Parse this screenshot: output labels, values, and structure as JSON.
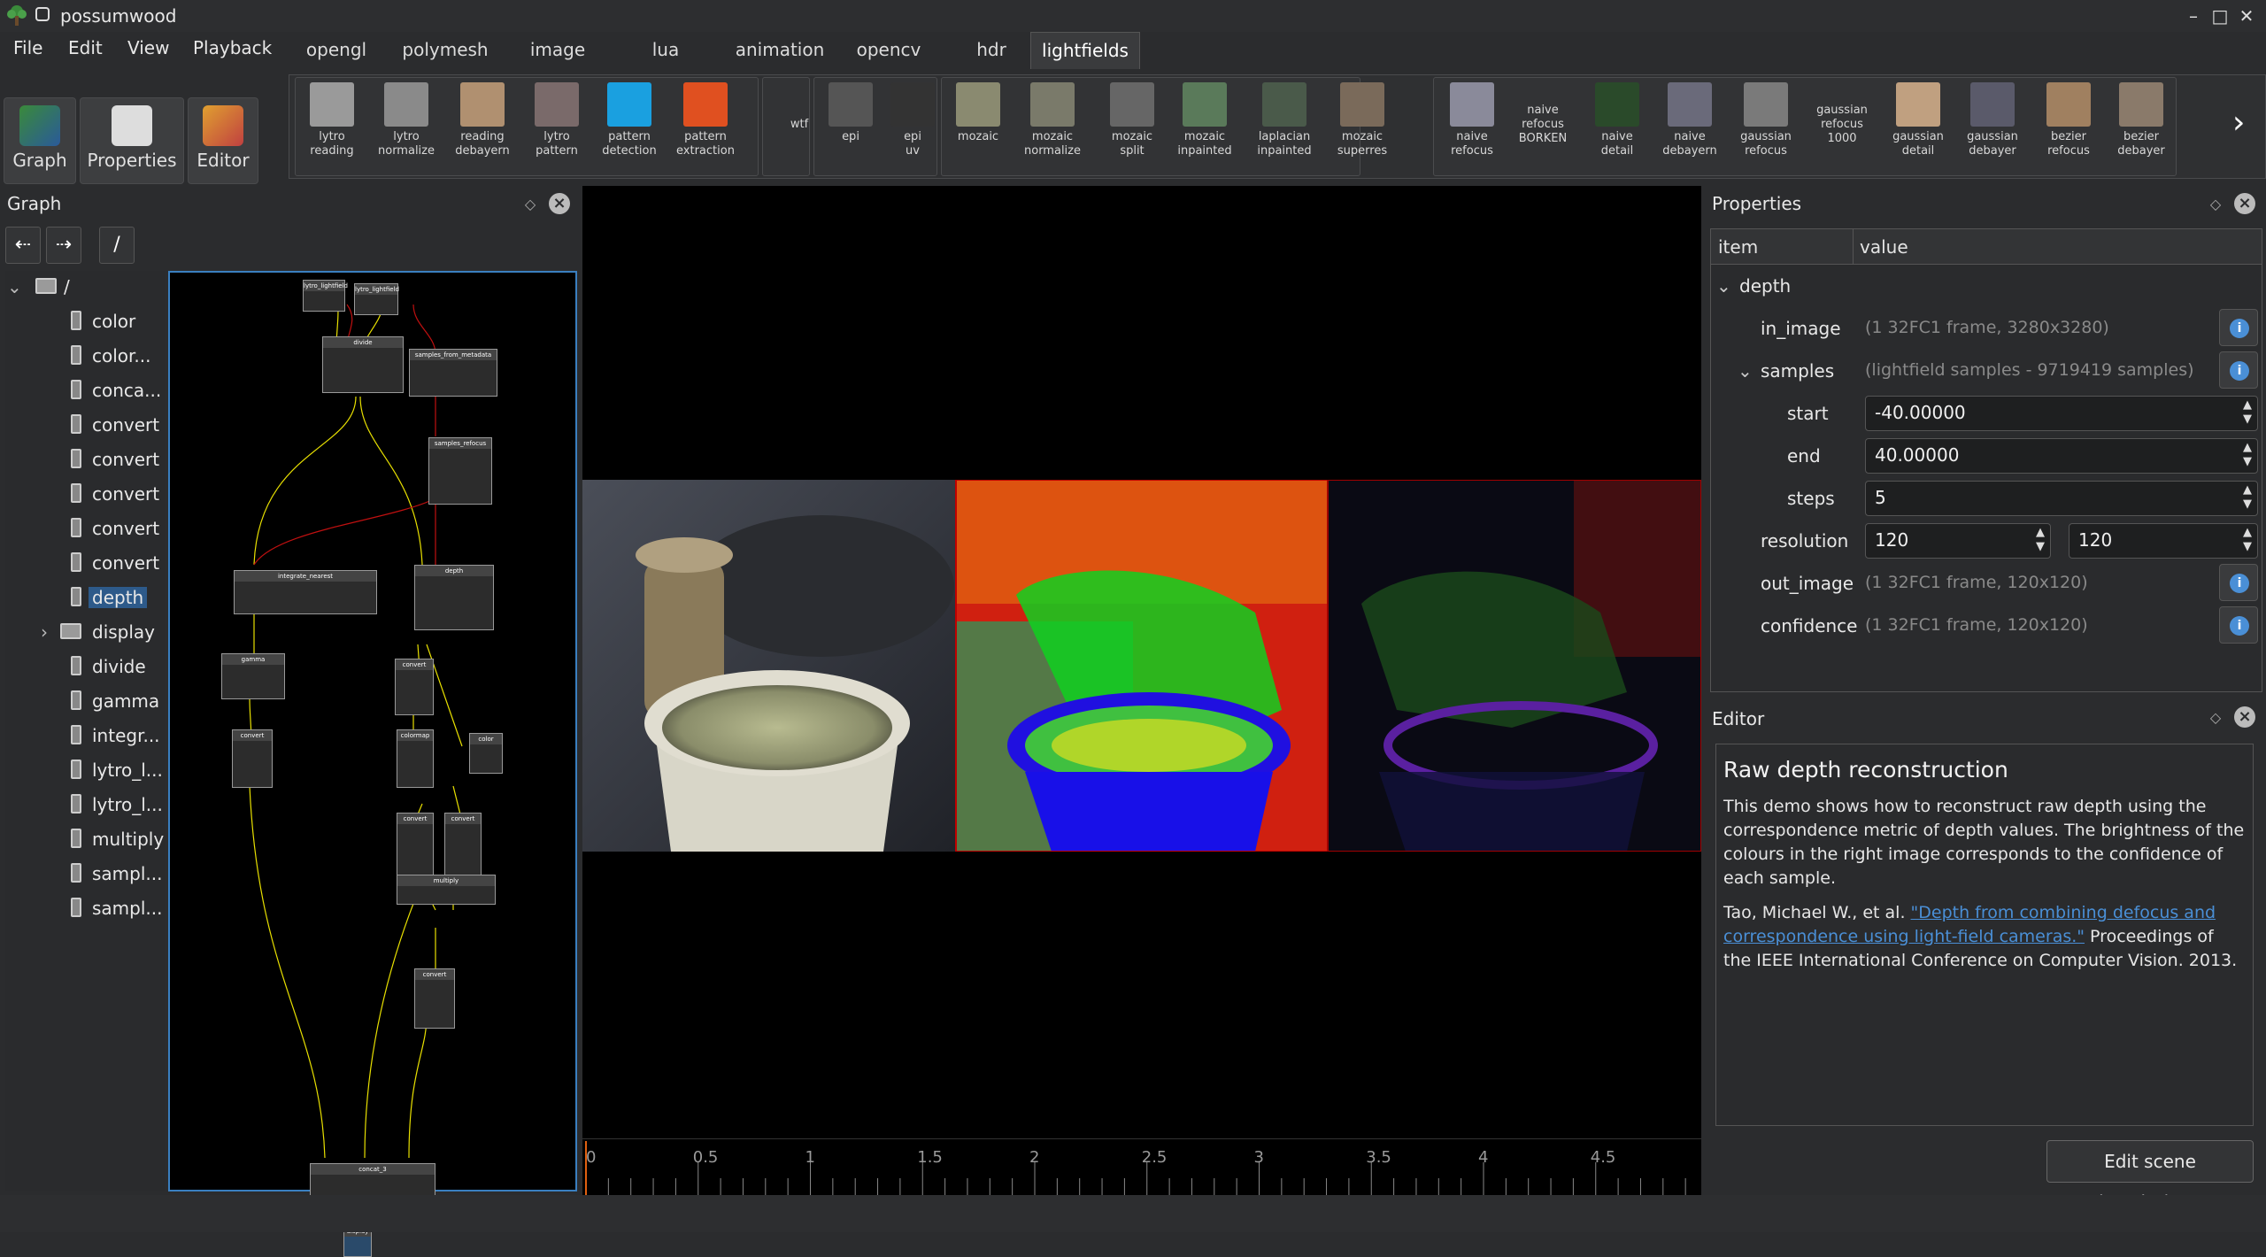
{
  "window": {
    "title": "possumwood",
    "minimize": "–",
    "maximize": "□",
    "close": "✕"
  },
  "menu": [
    "File",
    "Edit",
    "View",
    "Playback"
  ],
  "tabs": [
    "opengl",
    "polymesh",
    "image",
    "lua",
    "animation",
    "opencv",
    "hdr",
    "lightfields"
  ],
  "active_tab": "lightfields",
  "main_buttons": [
    {
      "label": "Graph",
      "icon": "graph-icon"
    },
    {
      "label": "Properties",
      "icon": "properties-icon"
    },
    {
      "label": "Editor",
      "icon": "editor-icon"
    }
  ],
  "shelf": [
    {
      "label": "lytro\nreading",
      "thumb": "#9a9a9a"
    },
    {
      "label": "lytro\nnormalize",
      "thumb": "#8a8a8a"
    },
    {
      "label": "reading\ndebayern",
      "thumb": "#b09070"
    },
    {
      "label": "lytro\npattern",
      "thumb": "#7a6a6a"
    },
    {
      "label": "pattern\ndetection",
      "thumb": "#1aa0e0"
    },
    {
      "label": "pattern\nextraction",
      "thumb": "#e05020"
    },
    {
      "label": "wtf",
      "thumb": ""
    },
    {
      "label": "epi",
      "thumb": "#555"
    },
    {
      "label": "epi\nuv",
      "thumb": "#333"
    },
    {
      "label": "mozaic",
      "thumb": "#8a8a70"
    },
    {
      "label": "mozaic\nnormalize",
      "thumb": "#7a7a6a"
    },
    {
      "label": "mozaic\nsplit",
      "thumb": "#666"
    },
    {
      "label": "mozaic\ninpainted",
      "thumb": "#5a7a5a"
    },
    {
      "label": "laplacian\ninpainted",
      "thumb": "#4a5a4a"
    },
    {
      "label": "mozaic\nsuperres",
      "thumb": "#7a6a5a"
    },
    {
      "label": "naive\nrefocus",
      "thumb": "#8a8a9a"
    },
    {
      "label": "naive\nrefocus\nBORKEN",
      "thumb": ""
    },
    {
      "label": "naive\ndetail",
      "thumb": "#2a4a2a"
    },
    {
      "label": "naive\ndebayern",
      "thumb": "#6a6a7a"
    },
    {
      "label": "gaussian\nrefocus",
      "thumb": "#7a7a7a"
    },
    {
      "label": "gaussian\nrefocus\n1000",
      "thumb": ""
    },
    {
      "label": "gaussian\ndetail",
      "thumb": "#c0a080"
    },
    {
      "label": "gaussian\ndebayer",
      "thumb": "#5a5a6a"
    },
    {
      "label": "bezier\nrefocus",
      "thumb": "#a08060"
    },
    {
      "label": "bezier\ndebayer",
      "thumb": "#8a7a6a"
    }
  ],
  "graph_panel": {
    "title": "Graph",
    "path": "/",
    "back": "⇠",
    "fwd": "⇢",
    "tree": [
      {
        "label": "/",
        "type": "folder"
      },
      {
        "label": "color",
        "type": "node"
      },
      {
        "label": "color...",
        "type": "node"
      },
      {
        "label": "conca...",
        "type": "node"
      },
      {
        "label": "convert",
        "type": "node"
      },
      {
        "label": "convert",
        "type": "node"
      },
      {
        "label": "convert",
        "type": "node"
      },
      {
        "label": "convert",
        "type": "node"
      },
      {
        "label": "convert",
        "type": "node"
      },
      {
        "label": "depth",
        "type": "node",
        "selected": true
      },
      {
        "label": "display",
        "type": "folder"
      },
      {
        "label": "divide",
        "type": "node"
      },
      {
        "label": "gamma",
        "type": "node"
      },
      {
        "label": "integr...",
        "type": "node"
      },
      {
        "label": "lytro_l...",
        "type": "node"
      },
      {
        "label": "lytro_l...",
        "type": "node"
      },
      {
        "label": "multiply",
        "type": "node"
      },
      {
        "label": "sampl...",
        "type": "node"
      },
      {
        "label": "sampl...",
        "type": "node"
      }
    ]
  },
  "graph_nodes": [
    "lytro_lightfield",
    "lytro_lightfield",
    "divide",
    "samples_from_metadata",
    "samples_refocus",
    "integrate_nearest",
    "depth",
    "gamma",
    "convert",
    "convert",
    "colormap",
    "color",
    "convert",
    "convert",
    "multiply",
    "convert",
    "concat_3",
    "display"
  ],
  "timeline": {
    "ticks": [
      "0",
      "0.5",
      "1",
      "1.5",
      "2",
      "2.5",
      "3",
      "3.5",
      "4",
      "4.5"
    ]
  },
  "properties": {
    "title": "Properties",
    "col_item": "item",
    "col_value": "value",
    "root": "depth",
    "in_image": {
      "label": "in_image",
      "value": "(1 32FC1 frame, 3280x3280)"
    },
    "samples": {
      "label": "samples",
      "value": "(lightfield samples - 9719419 samples)"
    },
    "start": {
      "label": "start",
      "value": "-40.00000"
    },
    "end": {
      "label": "end",
      "value": "40.00000"
    },
    "steps": {
      "label": "steps",
      "value": "5"
    },
    "resolution": {
      "label": "resolution",
      "value1": "120",
      "value2": "120"
    },
    "out_image": {
      "label": "out_image",
      "value": "(1 32FC1 frame, 120x120)"
    },
    "confidence": {
      "label": "confidence",
      "value": "(1 32FC1 frame, 120x120)"
    }
  },
  "editor": {
    "title": "Editor",
    "heading": "Raw depth reconstruction",
    "p1": "This demo shows how to reconstruct raw depth using the correspondence metric of depth values. The brightness of the colours in the right image corresponds to the confidence of each sample.",
    "p2_pre": "Tao, Michael W., et al. ",
    "p2_link": "\"Depth from combining defocus and correspondence using light-field cameras.\"",
    "p2_post": " Proceedings of the IEEE International Conference on Computer Vision. 2013.",
    "button": "Edit scene description..."
  }
}
